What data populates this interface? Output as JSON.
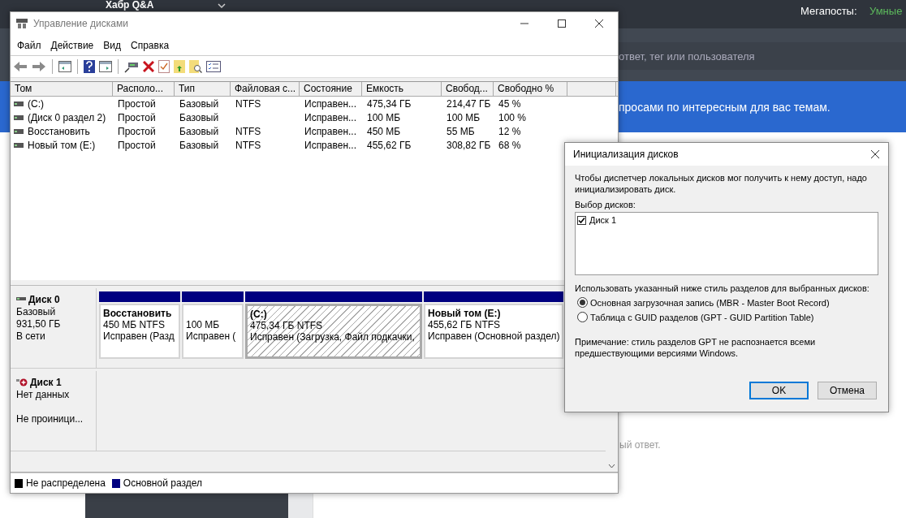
{
  "background": {
    "brand": "Хабр Q&A",
    "megaposts_label": "Мегапосты:",
    "megaposts_value": "Умные",
    "search_placeholder": "ответ, тег или пользователя",
    "banner_text": "просами по интересным для вас темам.",
    "answer_hint": "ый ответ."
  },
  "window": {
    "title": "Управление дисками",
    "menu": [
      "Файл",
      "Действие",
      "Вид",
      "Справка"
    ],
    "volume_table": {
      "columns": [
        "Том",
        "Располо...",
        "Тип",
        "Файловая с...",
        "Состояние",
        "Емкость",
        "Свобод...",
        "Свободно %"
      ],
      "rows": [
        {
          "cells": [
            "(C:)",
            "Простой",
            "Базовый",
            "NTFS",
            "Исправен...",
            "475,34 ГБ",
            "214,47 ГБ",
            "45 %"
          ]
        },
        {
          "cells": [
            "(Диск 0 раздел 2)",
            "Простой",
            "Базовый",
            "",
            "Исправен...",
            "100 МБ",
            "100 МБ",
            "100 %"
          ]
        },
        {
          "cells": [
            "Восстановить",
            "Простой",
            "Базовый",
            "NTFS",
            "Исправен...",
            "450 МБ",
            "55 МБ",
            "12 %"
          ]
        },
        {
          "cells": [
            "Новый том (E:)",
            "Простой",
            "Базовый",
            "NTFS",
            "Исправен...",
            "455,62 ГБ",
            "308,82 ГБ",
            "68 %"
          ]
        }
      ]
    },
    "disks": [
      {
        "name": "Диск 0",
        "kind": "online",
        "type": "Базовый",
        "capacity": "931,50 ГБ",
        "status": "В сети",
        "partitions": [
          {
            "name": "Восстановить",
            "size": "450 МБ NTFS",
            "status": "Исправен (Разд",
            "selected": false
          },
          {
            "size": "100 МБ",
            "status": "Исправен (",
            "selected": false
          },
          {
            "name": "(C:)",
            "size": "475,34 ГБ NTFS",
            "status": "Исправен (Загрузка, Файл подкачки,",
            "selected": true
          },
          {
            "name": "Новый том  (E:)",
            "size": "455,62 ГБ NTFS",
            "status": "Исправен (Основной раздел)",
            "selected": false
          }
        ]
      },
      {
        "name": "Диск 1",
        "kind": "not_initialized",
        "type": "Нет данных",
        "status": "Не проиници..."
      }
    ],
    "legend": [
      {
        "label": "Не распределена",
        "color": "#000000"
      },
      {
        "label": "Основной раздел",
        "color": "#000080"
      }
    ]
  },
  "dialog": {
    "title": "Инициализация дисков",
    "intro": "Чтобы диспетчер локальных дисков мог получить к нему доступ, надо инициализировать диск.",
    "select_label": "Выбор дисков:",
    "disks": [
      {
        "label": "Диск 1",
        "checked": true
      }
    ],
    "style_label": "Использовать указанный ниже стиль разделов для выбранных дисков:",
    "options": [
      {
        "label": "Основная загрузочная запись (MBR - Master Boot Record)",
        "selected": true
      },
      {
        "label": "Таблица с GUID разделов (GPT - GUID Partition Table)",
        "selected": false
      }
    ],
    "note": "Примечание: стиль разделов GPT не распознается всеми предшествующими версиями Windows.",
    "buttons": [
      {
        "label": "OK",
        "default": true
      },
      {
        "label": "Отмена",
        "default": false
      }
    ]
  }
}
